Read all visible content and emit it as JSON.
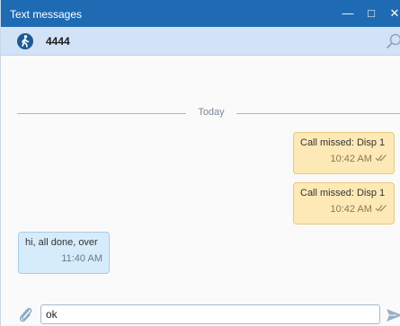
{
  "window": {
    "title": "Text messages",
    "minimize_glyph": "—",
    "maximize_glyph": "□",
    "close_glyph": "✕"
  },
  "contact": {
    "name": "4444",
    "avatar_icon": "walking-person-icon",
    "search_icon": "search-icon"
  },
  "conversation": {
    "date_divider": "Today",
    "messages": [
      {
        "direction": "outgoing",
        "text": "Call missed: Disp 1",
        "time": "10:42 AM",
        "status_icon": "double-check-icon"
      },
      {
        "direction": "outgoing",
        "text": "Call missed: Disp 1",
        "time": "10:42 AM",
        "status_icon": "double-check-icon"
      },
      {
        "direction": "incoming",
        "text": "hi, all done, over",
        "time": "11:40 AM"
      }
    ]
  },
  "composer": {
    "input_value": "ok",
    "attach_icon": "paperclip-icon",
    "send_icon": "send-icon"
  },
  "colors": {
    "titlebar": "#1f6bb3",
    "contact_bar": "#d2e3f7",
    "outgoing_bubble": "#fde9b6",
    "incoming_bubble": "#d6ecfb"
  }
}
